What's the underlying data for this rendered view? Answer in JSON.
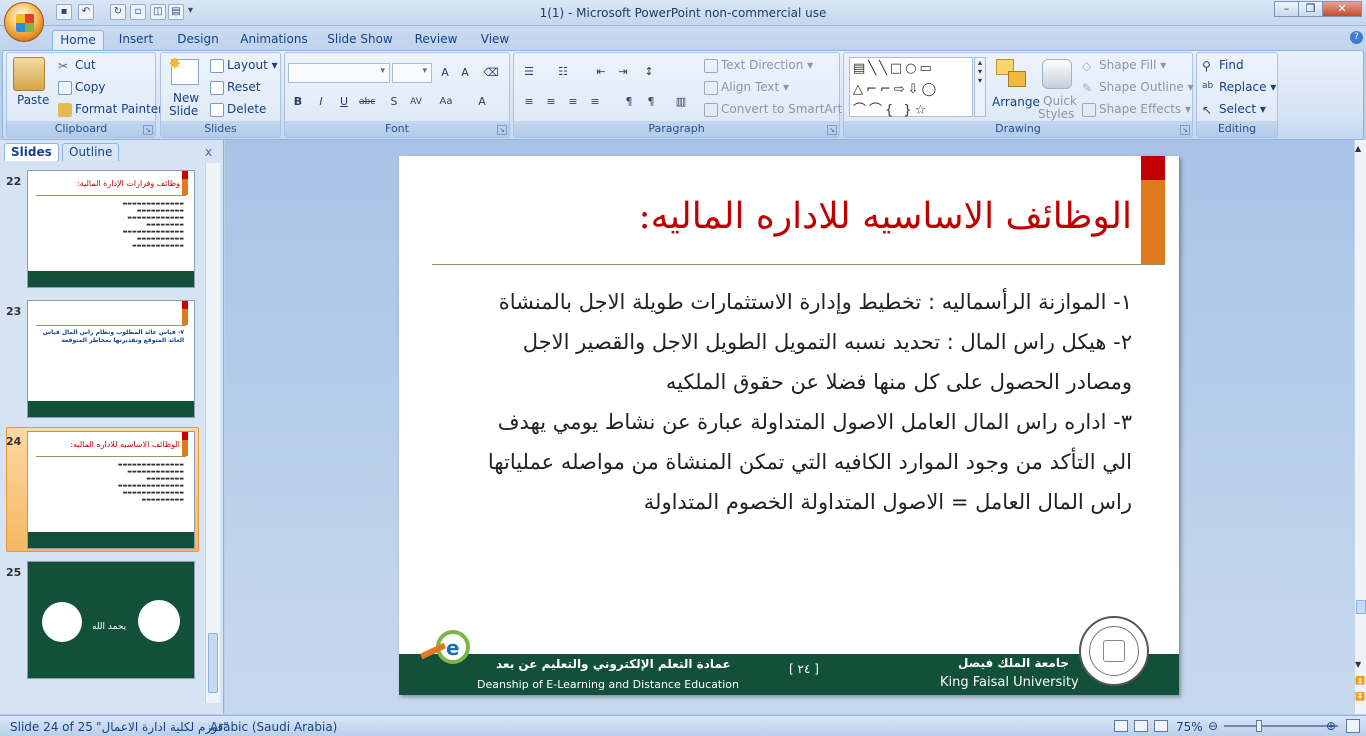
{
  "window": {
    "title": "1(1)  -  Microsoft PowerPoint non-commercial use"
  },
  "ribbon_tabs": [
    "Home",
    "Insert",
    "Design",
    "Animations",
    "Slide Show",
    "Review",
    "View"
  ],
  "clipboard": {
    "paste": "Paste",
    "cut": "Cut",
    "copy": "Copy",
    "format_painter": "Format Painter",
    "label": "Clipboard"
  },
  "slides_group": {
    "new_slide_1": "New",
    "new_slide_2": "Slide",
    "layout": "Layout",
    "reset": "Reset",
    "delete": "Delete",
    "label": "Slides"
  },
  "font_group": {
    "label": "Font"
  },
  "paragraph_group": {
    "text_direction": "Text Direction",
    "align_text": "Align Text",
    "convert": "Convert to SmartArt",
    "label": "Paragraph"
  },
  "drawing_group": {
    "arrange": "Arrange",
    "quick_styles_1": "Quick",
    "quick_styles_2": "Styles",
    "shape_fill": "Shape Fill",
    "shape_outline": "Shape Outline",
    "shape_effects": "Shape Effects",
    "label": "Drawing"
  },
  "editing_group": {
    "find": "Find",
    "replace": "Replace",
    "select": "Select",
    "label": "Editing"
  },
  "pane": {
    "tab_slides": "Slides",
    "tab_outline": "Outline",
    "close": "x"
  },
  "thumbnails": [
    {
      "num": "22",
      "title": "وظائف وقرارات الإدارة المالية:"
    },
    {
      "num": "23",
      "title": "٧- قياس عائد المطلوب ونظام راس المال قياس العائد المتوقع وتقديرتها بمخاطر المتوقعة"
    },
    {
      "num": "24",
      "title": "الوظائف الاساسيه للاداره الماليه:"
    },
    {
      "num": "25",
      "title": ""
    }
  ],
  "slide": {
    "title": "الوظائف الاساسيه للاداره الماليه:",
    "lines": [
      "١- الموازنة الرأسماليه : تخطيط وإدارة الاستثمارات طويلة الاجل بالمنشاة",
      "٢- هيكل راس المال : تحديد نسبه التمويل الطويل الاجل والقصير الاجل",
      "ومصادر الحصول على كل منها فضلا عن حقوق الملكيه",
      "٣- اداره راس المال العامل الاصول المتداولة عبارة عن نشاط يومي يهدف",
      "الي التأكد من وجود الموارد الكافيه التي تمكن المنشاة من مواصله عملياتها",
      "راس المال العامل = الاصول المتداولة الخصوم المتداولة"
    ],
    "footer": {
      "deanship_ar": "عمادة التعلم الإلكتروني والتعليم عن بعد",
      "deanship_en": "Deanship of E-Learning and Distance Education",
      "page": "[ ٢٤ ]",
      "univ_ar": "جامعة الملك فيصل",
      "univ_en": "King Faisal University"
    }
  },
  "thumb25": {
    "text": "يحمد الله"
  },
  "status": {
    "slide": "Slide 24 of 25",
    "theme": "\"قوزم لكلية ادارة الاعمال\"",
    "language": "Arabic (Saudi Arabia)",
    "zoom": "75%"
  }
}
